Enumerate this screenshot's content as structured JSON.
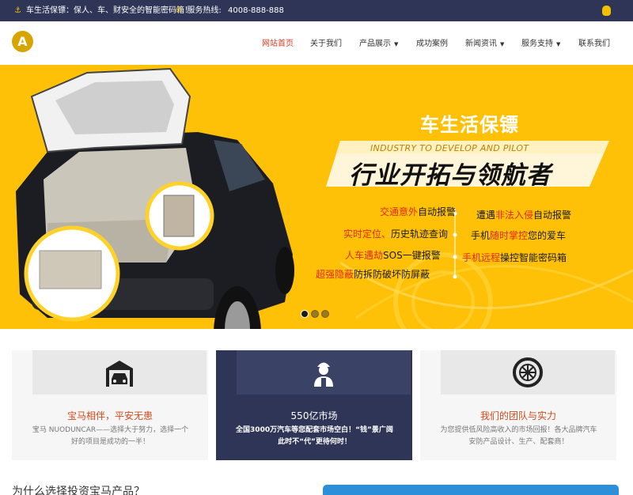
{
  "topbar": {
    "slogan": "车生活保镖：保人、车、财安全的智能密码箱！",
    "hotline_label": "服务热线:",
    "hotline_number": "4008-888-888"
  },
  "header": {
    "logo_letter": "A",
    "nav": [
      {
        "label": "网站首页",
        "active": true,
        "has_caret": false
      },
      {
        "label": "关于我们",
        "active": false,
        "has_caret": false
      },
      {
        "label": "产品展示",
        "active": false,
        "has_caret": true
      },
      {
        "label": "成功案例",
        "active": false,
        "has_caret": false
      },
      {
        "label": "新闻资讯",
        "active": false,
        "has_caret": true
      },
      {
        "label": "服务支持",
        "active": false,
        "has_caret": true
      },
      {
        "label": "联系我们",
        "active": false,
        "has_caret": false
      }
    ]
  },
  "hero": {
    "title": "车生活保镖",
    "subtitle": "INDUSTRY TO DEVELOP AND PILOT",
    "main": "行业开拓与领航者",
    "features_left": [
      {
        "red": "交通意外",
        "rest": "自动报警"
      },
      {
        "red": "实时定位、",
        "rest": "历史轨迹查询"
      },
      {
        "red": "人车遇劫",
        "rest": "SOS一键报警"
      },
      {
        "red": "超强隐蔽",
        "rest": "防拆防破坏防屏蔽"
      }
    ],
    "features_right": [
      {
        "pre": "遭遇",
        "red": "非法入侵",
        "rest": "自动报警"
      },
      {
        "pre": "手机",
        "red": "随时掌控",
        "rest": "您的爱车"
      },
      {
        "pre": "",
        "red": "手机远程",
        "rest": "操控智能密码箱"
      }
    ],
    "slides": 3,
    "active_slide": 0,
    "colors": {
      "background": "#ffc107",
      "accent_red": "#e22a1a"
    }
  },
  "cards": [
    {
      "icon": "garage-car-icon",
      "title": "宝马相伴，平安无患",
      "desc": "宝马 NUODUNCAR——选择大于努力，选择一个好的项目是成功的一半！",
      "dark": false
    },
    {
      "icon": "worker-icon",
      "title": "550亿市场",
      "desc": "全国3000万汽车等您配套市场空白！“钱”景广阔 此时不“代”更待何时！",
      "dark": true
    },
    {
      "icon": "tire-icon",
      "title": "我们的团队与实力",
      "desc": "为您提供低风险高收入的市场回报！各大品牌汽车安防产品设计、生产、配套商！",
      "dark": false
    }
  ],
  "bottom": {
    "why_title": "为什么选择投资宝马产品？"
  }
}
